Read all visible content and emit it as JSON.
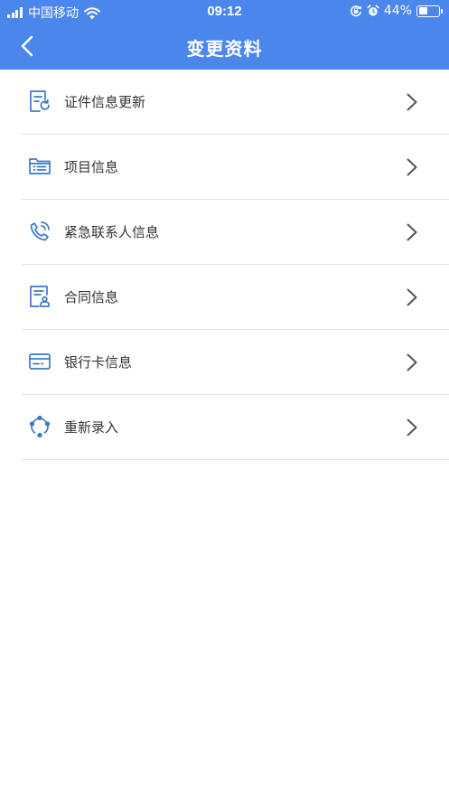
{
  "status_bar": {
    "carrier": "中国移动",
    "time": "09:12",
    "battery_text": "44%",
    "battery_level": 0.44,
    "icons": [
      "signal-icon",
      "wifi-icon",
      "rotation-lock-icon",
      "alarm-icon",
      "battery-icon"
    ]
  },
  "header": {
    "title": "变更资料",
    "back_icon": "back-arrow-icon"
  },
  "colors": {
    "header_bg": "#4a86ec",
    "icon_color": "#3f78c8",
    "divider": "#e2e2e2",
    "text": "#333333",
    "chevron": "#555555"
  },
  "menu": {
    "items": [
      {
        "label": "证件信息更新",
        "icon": "document-refresh-icon"
      },
      {
        "label": "项目信息",
        "icon": "folder-list-icon"
      },
      {
        "label": "紧急联系人信息",
        "icon": "phone-call-icon"
      },
      {
        "label": "合同信息",
        "icon": "contract-icon"
      },
      {
        "label": "银行卡信息",
        "icon": "bank-card-icon"
      },
      {
        "label": "重新录入",
        "icon": "cycle-icon"
      }
    ]
  }
}
